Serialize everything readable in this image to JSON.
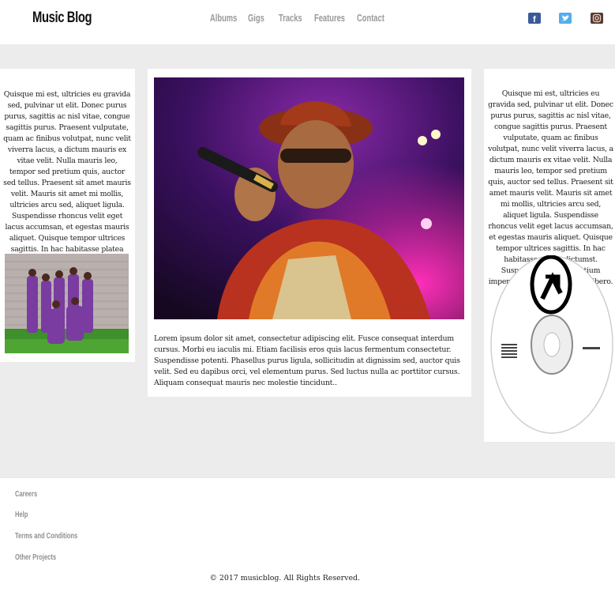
{
  "header": {
    "logo": "Music Blog",
    "nav": [
      {
        "label": "Albums"
      },
      {
        "label": "Gigs"
      },
      {
        "label": "Tracks"
      },
      {
        "label": "Features"
      },
      {
        "label": "Contact"
      }
    ],
    "social": [
      {
        "icon": "facebook-icon",
        "color": "#3b5998"
      },
      {
        "icon": "twitter-icon",
        "color": "#55acee"
      },
      {
        "icon": "instagram-icon",
        "color": "#5a3a2e"
      }
    ]
  },
  "left_card": {
    "text": "Quisque mi est, ultricies eu gravida sed, pulvinar ut elit. Donec purus purus, sagittis ac nisl vitae, congue sagittis purus. Praesent vulputate, quam ac finibus volutpat, nunc velit viverra lacus, a dictum mauris ex vitae velit. Nulla mauris leo, tempor sed pretium quis, auctor sed tellus. Praesent sit amet mauris velit. Mauris sit amet mi mollis, ultricies arcu sed, aliquet ligula. Suspendisse rhoncus velit eget lacus accumsan, et egestas mauris aliquet. Quisque tempor ultrices sagittis. In hac habitasse platea dictumst. Suspendisse varius pretium imperdiet. Quisque ac lacus libero."
  },
  "middle_card": {
    "text": "Lorem ipsum dolor sit amet, consectetur adipiscing elit. Fusce consequat interdum cursus. Morbi eu iaculis mi. Etiam facilisis eros quis lacus fermentum consectetur. Suspendisse potenti. Phasellus purus ligula, sollicitudin at dignissim sed, auctor quis velit. Sed eu dapibus orci, vel elementum purus. Sed luctus nulla ac porttitor cursus. Aliquam consequat mauris nec molestie tincidunt.."
  },
  "right_card": {
    "text": "Quisque mi est, ultricies eu gravida sed, pulvinar ut elit. Donec purus purus, sagittis ac nisl vitae, congue sagittis purus. Praesent vulputate, quam ac finibus volutpat, nunc velit viverra lacus, a dictum mauris ex vitae velit. Nulla mauris leo, tempor sed pretium quis, auctor sed tellus. Praesent sit amet mauris velit. Mauris sit amet mi mollis, ultricies arcu sed, aliquet ligula. Suspendisse rhoncus velit eget lacus accumsan, et egestas mauris aliquet. Quisque tempor ultrices sagittis. In hac habitasse platea dictumst. Suspendisse varius pretium imperdiet. Quisque ac lacus libero."
  },
  "footer": {
    "links": [
      {
        "label": "Careers"
      },
      {
        "label": "Help"
      },
      {
        "label": "Terms and Conditions"
      },
      {
        "label": "Other Projects"
      }
    ],
    "copyright": "© 2017 musicblog. All Rights Reserved."
  }
}
